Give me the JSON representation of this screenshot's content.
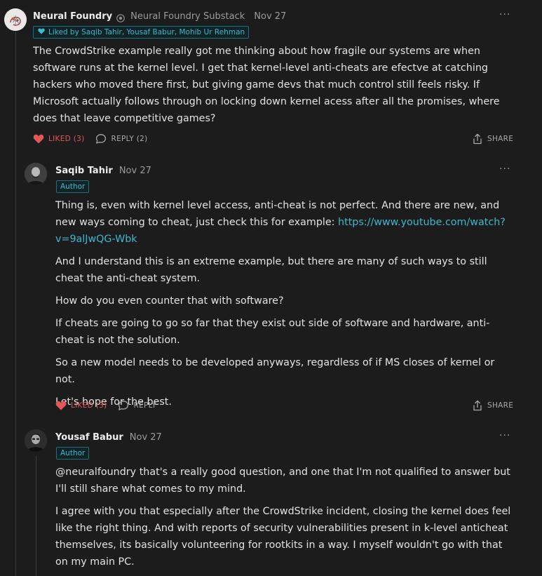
{
  "comments": [
    {
      "author": "Neural Foundry",
      "publication": "Neural Foundry Substack",
      "date": "Nov 27",
      "liked_by": "Liked by Saqib Tahir, Yousaf Babur, Mohib Ur Rehman",
      "paragraphs": [
        "The CrowdStrike example really got me thinking about how fragile our systems are when software runs at the kernel level. I get that kernel-level anti-cheats are efectve at catching hackers who moved there first, but giving game devs that much control still feels risky. If Microsoft actually follows through on locking down kernel acess after all the promises, where does that leave competitive games?"
      ],
      "like_label": "LIKED (3)",
      "reply_label": "REPLY (2)",
      "share_label": "SHARE"
    },
    {
      "author": "Saqib Tahir",
      "date": "Nov 27",
      "badge": "Author",
      "intro": "Thing is, even with kernel level access, anti-cheat is not perfect. And there are new, and new ways coming to cheat, just check this for example: ",
      "link": "https://www.youtube.com/watch?v=9alJwQG-Wbk",
      "paragraphs": [
        "And I understand this is an extreme example, but there are many of such ways to still cheat the anti-cheat system.",
        "How do you even counter that with software?",
        "If cheats are going to go so far that they exist out side of software and hardware, anti-cheat is not the solution.",
        "So a new model needs to be developed anyways, regardless of if MS closes of kernel or not.",
        "Let's hope for the best."
      ],
      "like_label": "LIKED (3)",
      "reply_label": "REPLY",
      "share_label": "SHARE"
    },
    {
      "author": "Yousaf Babur",
      "date": "Nov 27",
      "badge": "Author",
      "paragraphs": [
        "@neuralfoundry that's a really good question, and one that I'm not qualified to answer but I'll still share what comes to my mind.",
        "I agree with you that especially after the CrowdStrike incident, closing the kernel does feel like the right thing. And with reports of security vulnerabilities present in k-level anticheat themselves, its basically volunteering for rootkits in a way. I myself wouldn't go with that on my main PC."
      ]
    }
  ],
  "icons": {
    "more": "more-horizontal-icon",
    "heart": "heart-icon",
    "reply": "speech-bubble-icon",
    "share": "share-icon",
    "verified": "verified-check-icon"
  },
  "colors": {
    "background": "#1c1c1c",
    "accent": "#3eb8cc",
    "liked": "#e45757",
    "muted": "#9b9b9b"
  }
}
